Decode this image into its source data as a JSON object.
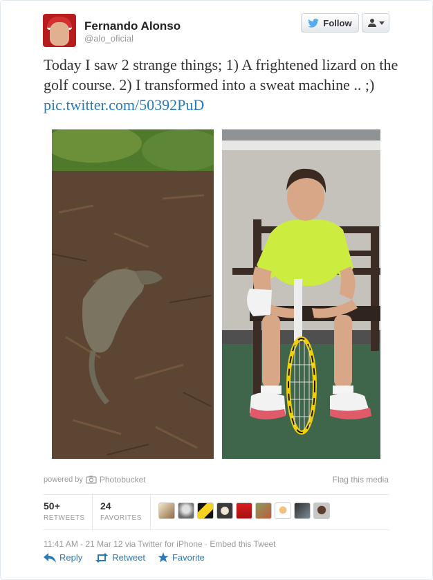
{
  "author": {
    "name": "Fernando Alonso",
    "handle": "@alo_oficial"
  },
  "buttons": {
    "follow": "Follow",
    "user_menu_icon": "user-dropdown-icon"
  },
  "tweet": {
    "text": "Today I saw 2 strange things; 1) A frightened lizard on the golf course. 2) I transformed into a sweat machine .. ;) ",
    "link": "pic.twitter.com/50392PuD"
  },
  "media": {
    "powered_by": "powered by",
    "provider": "Photobucket",
    "flag": "Flag this media"
  },
  "stats": {
    "retweets_count": "50+",
    "retweets_label": "RETWEETS",
    "favorites_count": "24",
    "favorites_label": "FAVORITES"
  },
  "meta": {
    "timestamp": "11:41 AM - 21 Mar 12 via Twitter for iPhone · Embed this Tweet"
  },
  "actions": {
    "reply": "Reply",
    "retweet": "Retweet",
    "favorite": "Favorite"
  },
  "colors": {
    "link": "#2b7bb9",
    "muted": "#999999",
    "text": "#333333"
  }
}
